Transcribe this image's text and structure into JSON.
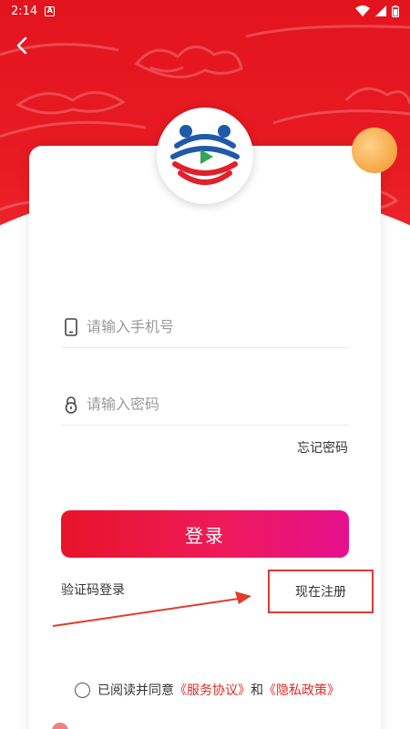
{
  "status_bar": {
    "time": "2:14",
    "notification_badge": "A"
  },
  "form": {
    "phone_placeholder": "请输入手机号",
    "password_placeholder": "请输入密码",
    "forgot_password": "忘记密码",
    "login_button": "登录",
    "sms_login": "验证码登录",
    "register": "现在注册"
  },
  "agreement": {
    "prefix": "已阅读并同意",
    "service_agreement": "《服务协议》",
    "and": "和",
    "privacy_policy": "《隐私政策》"
  },
  "icons": {
    "back": "back-arrow-icon",
    "phone": "phone-icon",
    "lock": "lock-icon",
    "wifi": "wifi-icon",
    "signal": "signal-icon",
    "battery": "battery-icon"
  },
  "colors": {
    "header_red": "#e3141e",
    "login_gradient_start": "#e8132a",
    "login_gradient_end": "#e6108f",
    "link_red": "#e02a26",
    "annotation_red": "#e23a2f"
  }
}
